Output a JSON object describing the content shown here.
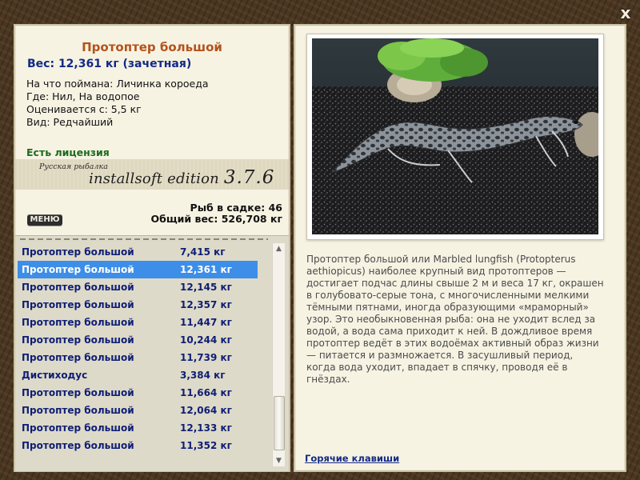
{
  "window": {
    "close_label": "x"
  },
  "catch": {
    "title": "Протоптер большой",
    "weight_line": "Вес: 12,361 кг (зачетная)",
    "bait": "На что поймана: Личинка короеда",
    "location": "Где: Нил, На водопое",
    "threshold": "Оценивается с: 5,5 кг",
    "rarity": "Вид: Редчайший",
    "license": "Есть лицензия"
  },
  "banner": {
    "small": "Русская рыбалка",
    "main": "installsoft edition",
    "version": "3.7.6"
  },
  "keepnet": {
    "count_line": "Рыб в садке: 46",
    "total_line": "Общий вес: 526,708 кг"
  },
  "menu_label": "МЕНЮ",
  "fish_list": [
    {
      "name": "Протоптер большой",
      "weight": "7,415 кг",
      "selected": false
    },
    {
      "name": "Протоптер большой",
      "weight": "12,361 кг",
      "selected": true
    },
    {
      "name": "Протоптер большой",
      "weight": "12,145 кг",
      "selected": false
    },
    {
      "name": "Протоптер большой",
      "weight": "12,357 кг",
      "selected": false
    },
    {
      "name": "Протоптер большой",
      "weight": "11,447 кг",
      "selected": false
    },
    {
      "name": "Протоптер большой",
      "weight": "10,244 кг",
      "selected": false
    },
    {
      "name": "Протоптер большой",
      "weight": "11,739 кг",
      "selected": false
    },
    {
      "name": "Дистиходус",
      "weight": "3,384 кг",
      "selected": false
    },
    {
      "name": "Протоптер большой",
      "weight": "11,664 кг",
      "selected": false
    },
    {
      "name": "Протоптер большой",
      "weight": "12,064 кг",
      "selected": false
    },
    {
      "name": "Протоптер большой",
      "weight": "12,133 кг",
      "selected": false
    },
    {
      "name": "Протоптер большой",
      "weight": "11,352 кг",
      "selected": false
    }
  ],
  "description": "Протоптер большой или Marbled lungfish (Protopterus aethiopicus) наиболее крупный вид протоптеров — достигает подчас длины свыше 2 м и веса 17 кг, окрашен в голубовато-серые тона, с многочисленными мелкими тёмными пятнами, иногда образующими «мраморный» узор. Это необыкновенная рыба: она не уходит вслед за водой, а вода сама приходит к ней. В дождливое время протоптер ведёт в этих водоёмах активный образ жизни — питается и размножается. В засушливый период, когда вода уходит, впадает в спячку, проводя её в гнёздах.",
  "hotkeys_label": "Горячие клавиши",
  "colors": {
    "title": "#b4521b",
    "weight": "#142a86",
    "license": "#1d6b1d",
    "list_text": "#0e1e75",
    "selection": "#3d8ee8",
    "panel": "#f6f3e3"
  }
}
